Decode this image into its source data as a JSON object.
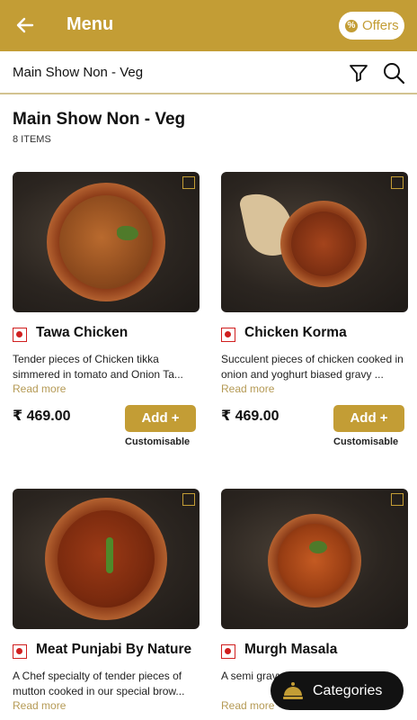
{
  "header": {
    "title": "Menu",
    "offers_label": "Offers"
  },
  "subheader": {
    "title": "Main Show Non - Veg"
  },
  "section": {
    "title": "Main Show Non - Veg",
    "count": "8 ITEMS"
  },
  "items": [
    {
      "name": "Tawa Chicken",
      "desc": "Tender pieces of Chicken tikka simmered in tomato and Onion Ta...",
      "read_more": "Read more",
      "price": "₹ 469.00",
      "add": "Add +",
      "custom": "Customisable"
    },
    {
      "name": "Chicken Korma",
      "desc": "Succulent pieces of chicken cooked in onion and yoghurt biased gravy ...",
      "read_more": "Read more",
      "price": "₹ 469.00",
      "add": "Add +",
      "custom": "Customisable"
    },
    {
      "name": "Meat Punjabi By Nature",
      "desc": "A Chef specialty of tender pieces of mutton cooked in our special brow...",
      "read_more": "Read more"
    },
    {
      "name": "Murgh Masala",
      "desc": "A semi gravy delicacy w",
      "read_more": "Read more"
    }
  ],
  "categories_button": {
    "label": "Categories"
  },
  "colors": {
    "brand": "#c39d35",
    "nonveg": "#d01f1f",
    "dark": "#121212"
  }
}
